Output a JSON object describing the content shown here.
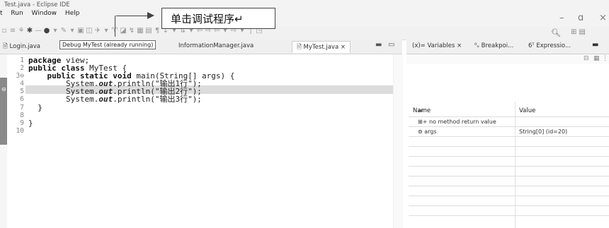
{
  "window": {
    "title": "Test.java - Eclipse IDE",
    "menu": [
      "t",
      "Run",
      "Window",
      "Help"
    ],
    "controls": [
      "–",
      "ɑ",
      "×"
    ]
  },
  "callout": {
    "text": "单击调试程序↵"
  },
  "tooltip": {
    "text": "Debug MyTest (already running)"
  },
  "editor_tabs": [
    "Login.java",
    "InformationManager.java",
    "MyTest.java ×"
  ],
  "line_numbers": [
    "1",
    "2",
    "3⊖",
    "4",
    "5",
    "6",
    "7",
    "8",
    "9",
    "10"
  ],
  "code_lines": [
    [
      "kw:package",
      " view;"
    ],
    [
      "kw:public class",
      " MyTest {"
    ],
    [
      "    ",
      "kw:public static void",
      " main(String[] args) {"
    ],
    [
      "        System.",
      "fld:out",
      ".println(\"输出1行\");"
    ],
    [
      "        System.",
      "fld:out",
      ".println(\"输出2行\");"
    ],
    [
      "        System.",
      "fld:out",
      ".println(\"输出3行\");"
    ],
    [
      "  }"
    ],
    [
      ""
    ],
    [
      "}"
    ],
    [
      ""
    ]
  ],
  "views": {
    "tabs": [
      "(x)= Variables ×",
      "⁰ₒ Breakpoi...",
      "6ᵀ Expressio..."
    ],
    "variables": {
      "headers": [
        "Name",
        "Value"
      ],
      "rows": [
        {
          "name": "⊞+ no method return value",
          "value": ""
        },
        {
          "name": "⊚  args",
          "value": "String[0]  (id=20)"
        }
      ]
    }
  },
  "toolbar_icons": [
    "search-icon",
    "perspective-icon"
  ]
}
